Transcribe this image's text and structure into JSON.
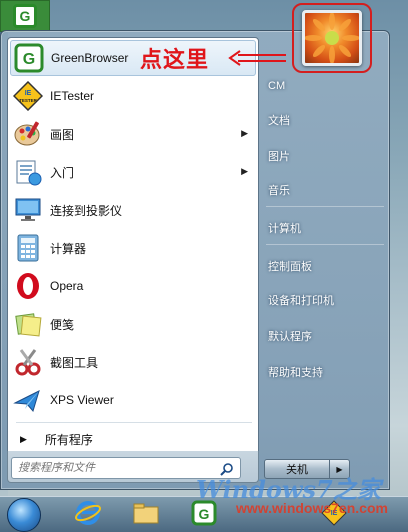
{
  "programs": [
    {
      "label": "GreenBrowser",
      "icon": "greenbrowser-icon",
      "has_submenu": false
    },
    {
      "label": "IETester",
      "icon": "ietester-icon",
      "has_submenu": false
    },
    {
      "label": "画图",
      "icon": "paint-icon",
      "has_submenu": true
    },
    {
      "label": "入门",
      "icon": "getting-started-icon",
      "has_submenu": true
    },
    {
      "label": "连接到投影仪",
      "icon": "projector-icon",
      "has_submenu": false
    },
    {
      "label": "计算器",
      "icon": "calculator-icon",
      "has_submenu": false
    },
    {
      "label": "Opera",
      "icon": "opera-icon",
      "has_submenu": false
    },
    {
      "label": "便笺",
      "icon": "sticky-notes-icon",
      "has_submenu": false
    },
    {
      "label": "截图工具",
      "icon": "snipping-tool-icon",
      "has_submenu": false
    },
    {
      "label": "XPS Viewer",
      "icon": "xps-viewer-icon",
      "has_submenu": false
    }
  ],
  "all_programs": "所有程序",
  "search": {
    "placeholder": "搜索程序和文件"
  },
  "right_items": [
    "CM",
    "文档",
    "图片",
    "音乐",
    "计算机",
    "控制面板",
    "设备和打印机",
    "默认程序",
    "帮助和支持"
  ],
  "shutdown_label": "关机",
  "annotation": "点这里",
  "watermark": {
    "line1": "Windows7之家",
    "line2": "www.windows7en.com"
  },
  "colors": {
    "annotation": "#e0151a",
    "highlight_border": "#a8c4dc"
  }
}
